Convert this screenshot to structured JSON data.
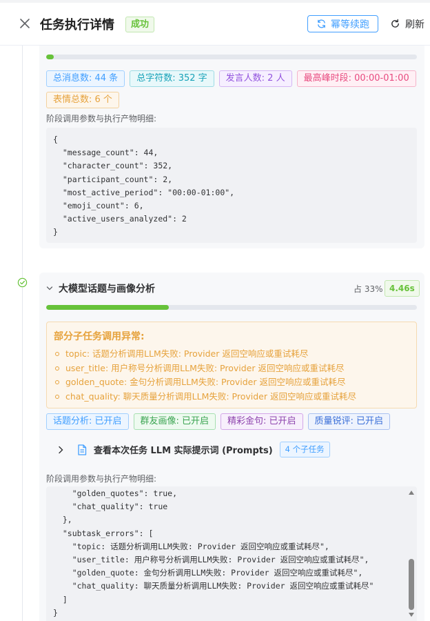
{
  "header": {
    "title": "任务执行详情",
    "status": "成功",
    "resume_label": "幂等续跑",
    "refresh_label": "刷新"
  },
  "stage1": {
    "progress": 0.02,
    "tags": [
      {
        "label": "总消息数: 44 条",
        "color": "blue"
      },
      {
        "label": "总字符数: 352 字",
        "color": "cyan"
      },
      {
        "label": "发言人数: 2 人",
        "color": "purple"
      },
      {
        "label": "最高峰时段: 00:00-01:00",
        "color": "pink"
      },
      {
        "label": "表情总数: 6 个",
        "color": "orange"
      }
    ],
    "params_label": "阶段调用参数与执行产物明细:",
    "code": "{\n  \"message_count\": 44,\n  \"character_count\": 352,\n  \"participant_count\": 2,\n  \"most_active_period\": \"00:00-01:00\",\n  \"emoji_count\": 6,\n  \"active_users_analyzed\": 2\n}"
  },
  "stage2": {
    "title": "大模型话题与画像分析",
    "percent": "占 33%",
    "duration": "4.46s",
    "progress": 0.33,
    "alert_title": "部分子任务调用异常:",
    "errors": [
      "topic: 话题分析调用LLM失败: Provider 返回空响应或重试耗尽",
      "user_title: 用户称号分析调用LLM失败: Provider 返回空响应或重试耗尽",
      "golden_quote: 金句分析调用LLM失败: Provider 返回空响应或重试耗尽",
      "chat_quality: 聊天质量分析调用LLM失败: Provider 返回空响应或重试耗尽"
    ],
    "tags": [
      {
        "label": "话题分析: 已开启",
        "color": "blue"
      },
      {
        "label": "群友画像: 已开启",
        "color": "green"
      },
      {
        "label": "精彩金句: 已开启",
        "color": "violet"
      },
      {
        "label": "质量锐评: 已开启",
        "color": "blue2"
      }
    ],
    "prompts_label": "查看本次任务 LLM 实际提示词 (Prompts)",
    "prompts_count": "4 个子任务",
    "params_label": "阶段调用参数与执行产物明细:",
    "code": "    \"golden_quotes\": true,\n    \"chat_quality\": true\n  },\n  \"subtask_errors\": [\n    \"topic: 话题分析调用LLM失败: Provider 返回空响应或重试耗尽\",\n    \"user_title: 用户称号分析调用LLM失败: Provider 返回空响应或重试耗尽\",\n    \"golden_quote: 金句分析调用LLM失败: Provider 返回空响应或重试耗尽\",\n    \"chat_quality: 聊天质量分析调用LLM失败: Provider 返回空响应或重试耗尽\"\n  ]\n}"
  },
  "colors": {
    "success": "#67c23a",
    "primary": "#409eff",
    "warning": "#e6a23c"
  }
}
